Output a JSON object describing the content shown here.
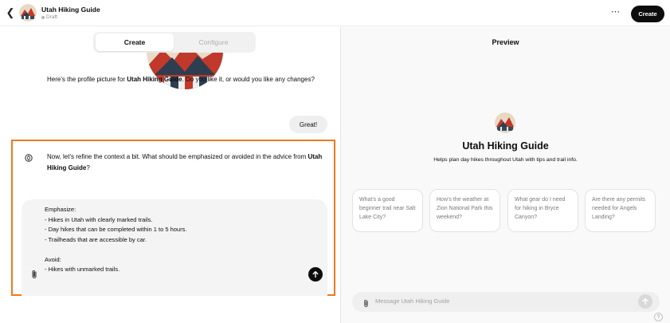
{
  "header": {
    "gpt_name": "Utah Hiking Guide",
    "status": "Draft",
    "more_icon": "ellipsis-icon",
    "create_label": "Create"
  },
  "tabs": {
    "create": "Create",
    "configure": "Configure"
  },
  "chat": {
    "msg1_prefix": "Here's the profile picture for ",
    "msg1_name": "Utah Hiking Guide",
    "msg1_suffix": ". Do you like it, or would you like any changes?",
    "user_reply": "Great!",
    "msg2_prefix": "Now, let's refine the context a bit. What should be emphasized or avoided in the advice from ",
    "msg2_name": "Utah Hiking Guide",
    "msg2_suffix": "?"
  },
  "composer": {
    "text": "Emphasize:\n- Hikes in Utah with clearly marked trails.\n- Day hikes that can be completed within 1 to 5 hours.\n- Trailheads that are accessible by car.\n\nAvoid:\n- Hikes with unmarked trails."
  },
  "preview": {
    "title": "Preview",
    "gpt_name": "Utah Hiking Guide",
    "description": "Helps plan day hikes throughout Utah with tips and trail info.",
    "starters": [
      "What's a good beginner trail near Salt Lake City?",
      "How's the weather at Zion National Park this weekend?",
      "What gear do I need for hiking in Bryce Canyon?",
      "Are there any permits needed for Angels Landing?"
    ],
    "message_placeholder": "Message Utah Hiking Guide",
    "help_label": "?"
  },
  "colors": {
    "highlight": "#f0781e",
    "primary": "#0d0d0d"
  }
}
